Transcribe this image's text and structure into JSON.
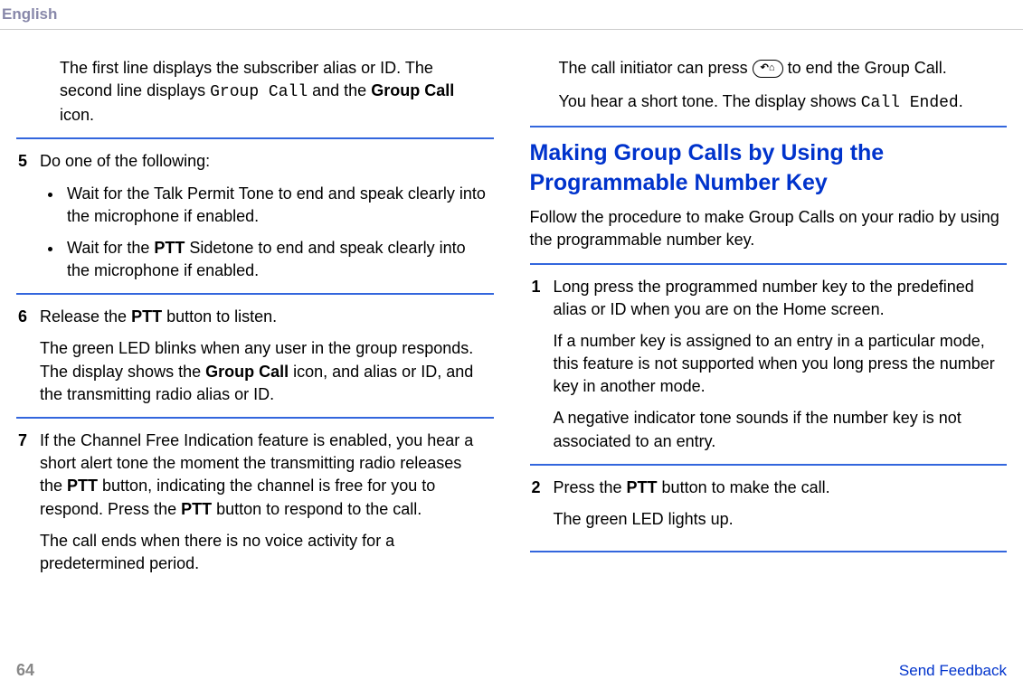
{
  "header": {
    "language": "English"
  },
  "left_column": {
    "intro_p1": "The first line displays the subscriber alias or ID. The second line displays ",
    "intro_mono": "Group Call",
    "intro_p1b": " and the ",
    "intro_bold": "Group Call",
    "intro_p1c": " icon.",
    "step5_number": "5",
    "step5_text": "Do one of the following:",
    "step5_bullet1": "Wait for the Talk Permit Tone to end and speak clearly into the microphone if enabled.",
    "step5_bullet2a": "Wait for the ",
    "step5_bullet2_bold": "PTT",
    "step5_bullet2b": " Sidetone to end and speak clearly into the microphone if enabled.",
    "step6_number": "6",
    "step6_text_a": "Release the ",
    "step6_text_bold": "PTT",
    "step6_text_b": " button to listen.",
    "step6_follow_a": "The green LED blinks when any user in the group responds. The display shows the ",
    "step6_follow_bold": "Group Call",
    "step6_follow_b": " icon, and alias or ID, and the transmitting radio alias or ID.",
    "step7_number": "7",
    "step7_text_a": "If the Channel Free Indication feature is enabled, you hear a short alert tone the moment the transmitting radio releases the ",
    "step7_text_bold1": "PTT",
    "step7_text_b": " button, indicating the channel is free for you to respond. Press the ",
    "step7_text_bold2": "PTT",
    "step7_text_c": " button to respond to the call.",
    "step7_follow": "The call ends when there is no voice activity for a predetermined period."
  },
  "right_column": {
    "initiator_a": "The call initiator can press ",
    "initiator_icon": "↶⌂",
    "initiator_b": " to end the Group Call.",
    "tone_a": "You hear a short tone. The display shows ",
    "tone_mono": "Call Ended",
    "tone_b": ".",
    "heading": "Making Group Calls by Using the Programmable Number Key",
    "intro": "Follow the procedure to make Group Calls on your radio by using the programmable number key.",
    "step1_number": "1",
    "step1_text": "Long press the programmed number key to the predefined alias or ID when you are on the Home screen.",
    "step1_follow1": "If a number key is assigned to an entry in a particular mode, this feature is not supported when you long press the number key in another mode.",
    "step1_follow2": "A negative indicator tone sounds if the number key is not associated to an entry.",
    "step2_number": "2",
    "step2_text_a": "Press the ",
    "step2_text_bold": "PTT",
    "step2_text_b": " button to make the call.",
    "step2_follow": "The green LED lights up."
  },
  "footer": {
    "page_number": "64",
    "send_feedback": "Send Feedback"
  }
}
